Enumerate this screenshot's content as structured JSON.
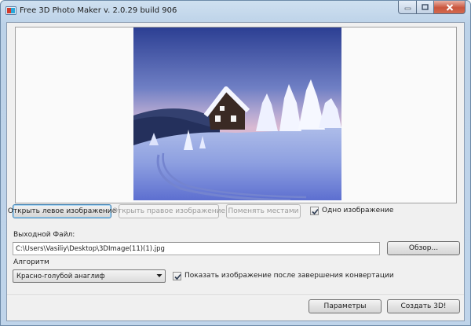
{
  "window": {
    "title": "Free 3D Photo Maker  v. 2.0.29 build 906"
  },
  "buttons": {
    "open_left": "Открыть левое изображение",
    "open_right": "Открыть правое изображение",
    "swap": "Поменять местами",
    "browse": "Обзор...",
    "params": "Параметры",
    "create": "Создать 3D!"
  },
  "options": {
    "single_image_label": "Одно изображение",
    "single_image_checked": true,
    "show_after_label": "Показать изображение после завершения конвертации",
    "show_after_checked": true
  },
  "output": {
    "label": "Выходной Файл:",
    "value": "C:\\Users\\Vasiliy\\Desktop\\3DImage(11)(1).jpg"
  },
  "algorithm": {
    "label": "Алгоритм",
    "selected": "Красно-голубой анаглиф"
  },
  "colors": {
    "title_bar": "#bcd2e8",
    "close_button": "#c9553d",
    "client_bg": "#f0f0f0"
  }
}
